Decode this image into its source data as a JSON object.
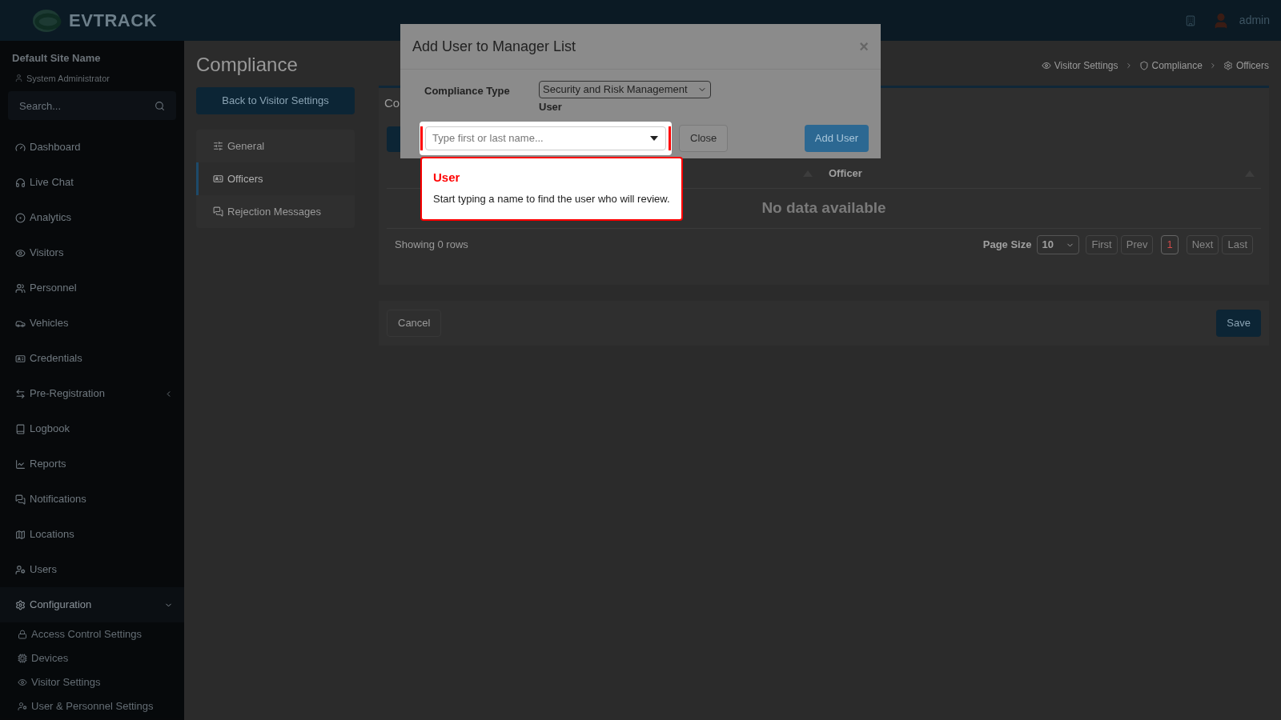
{
  "header": {
    "logo": "EVTRACK",
    "user": "admin"
  },
  "sidebar": {
    "site": "Default Site Name",
    "role": "System Administrator",
    "search": {
      "placeholder": "Search..."
    },
    "items": [
      {
        "kind": "link",
        "label": "Dashboard",
        "selected": false
      },
      {
        "kind": "link",
        "label": "Live Chat",
        "selected": false
      },
      {
        "kind": "link",
        "label": "Analytics",
        "selected": false
      },
      {
        "kind": "link",
        "label": "Visitors",
        "selected": false
      },
      {
        "kind": "link",
        "label": "Personnel",
        "selected": false
      },
      {
        "kind": "link",
        "label": "Vehicles",
        "selected": false
      },
      {
        "kind": "link",
        "label": "Credentials",
        "selected": false
      },
      {
        "kind": "group",
        "label": "Pre-Registration",
        "selected": false,
        "expanded": false
      },
      {
        "kind": "link",
        "label": "Logbook",
        "selected": false
      },
      {
        "kind": "link",
        "label": "Reports",
        "selected": false
      },
      {
        "kind": "link",
        "label": "Notifications",
        "selected": false
      },
      {
        "kind": "link",
        "label": "Locations",
        "selected": false
      },
      {
        "kind": "link",
        "label": "Users",
        "selected": false
      },
      {
        "kind": "group",
        "label": "Configuration",
        "selected": true,
        "expanded": true,
        "children": [
          {
            "label": "Access Control Settings"
          },
          {
            "label": "Devices"
          },
          {
            "label": "Visitor Settings"
          },
          {
            "label": "User & Personnel Settings"
          }
        ]
      }
    ]
  },
  "page": {
    "title": "Compliance",
    "back_button": "Back to Visitor Settings",
    "nav": [
      {
        "label": "General",
        "selected": false
      },
      {
        "label": "Officers",
        "selected": true
      },
      {
        "label": "Rejection Messages",
        "selected": false
      }
    ],
    "breadcrumbs": [
      "Visitor Settings",
      "Compliance",
      "Officers"
    ],
    "card": {
      "title": "Co",
      "table": {
        "columns": [
          {
            "label": "Officer"
          }
        ],
        "empty": "No data available"
      },
      "footer": {
        "summary": "Showing 0 rows",
        "page_size_label": "Page Size",
        "page_size": "10",
        "pages": [
          {
            "label": "First",
            "selected": false,
            "disabled": true
          },
          {
            "label": "Prev",
            "selected": false,
            "disabled": true
          },
          {
            "label": "1",
            "selected": true,
            "disabled": false
          },
          {
            "label": "Next",
            "selected": false,
            "disabled": true
          },
          {
            "label": "Last",
            "selected": false,
            "disabled": true
          }
        ]
      }
    },
    "actions": {
      "cancel": "Cancel",
      "save": "Save"
    }
  },
  "modal": {
    "title": "Add User to Manager List",
    "close_icon": "×",
    "compliance_type_label": "Compliance Type",
    "compliance_type": "Security and Risk Management",
    "user_label": "User",
    "user_field": {
      "placeholder": "Type first or last name..."
    },
    "close_button": "Close",
    "add_button": "Add User"
  },
  "tour_tip": {
    "title": "User",
    "text": "Start typing a name to find the user who will review."
  }
}
